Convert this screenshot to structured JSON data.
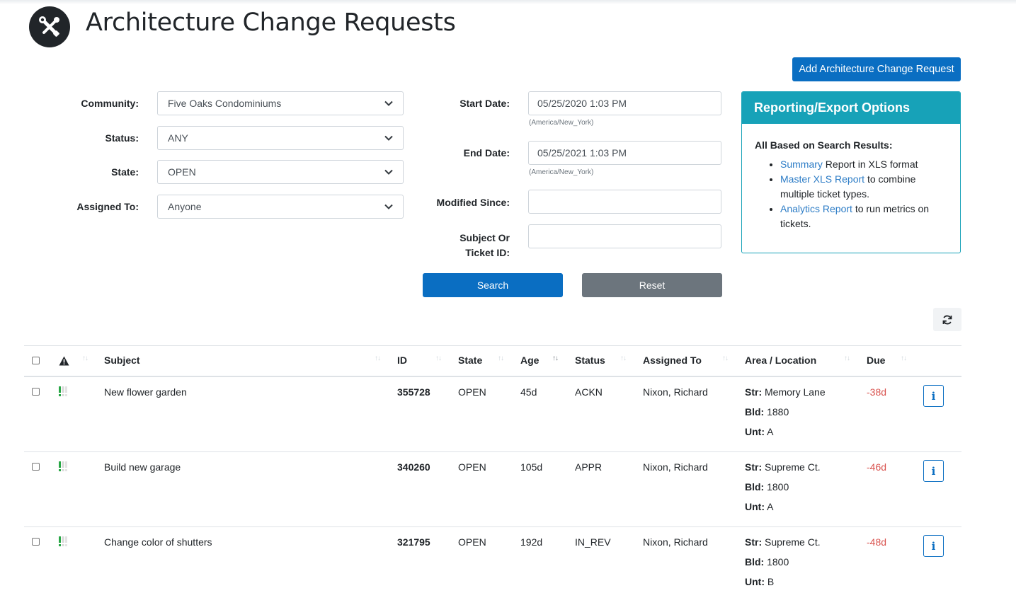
{
  "header": {
    "title": "Architecture Change Requests",
    "add_button": "Add Architecture Change Request"
  },
  "filters": {
    "community": {
      "label": "Community:",
      "value": "Five Oaks Condominiums"
    },
    "status": {
      "label": "Status:",
      "value": "ANY"
    },
    "state": {
      "label": "State:",
      "value": "OPEN"
    },
    "assigned": {
      "label": "Assigned To:",
      "value": "Anyone"
    },
    "start_date": {
      "label": "Start Date:",
      "value": "05/25/2020 1:03 PM",
      "tz": "(America/New_York)"
    },
    "end_date": {
      "label": "End Date:",
      "value": "05/25/2021 1:03 PM",
      "tz": "(America/New_York)"
    },
    "modified_since": {
      "label": "Modified Since:",
      "value": ""
    },
    "subject": {
      "label_line1": "Subject Or",
      "label_line2": "Ticket ID:",
      "value": ""
    },
    "search_button": "Search",
    "reset_button": "Reset"
  },
  "report": {
    "title": "Reporting/Export Options",
    "subtitle": "All Based on Search Results:",
    "items": [
      {
        "link": "Summary",
        "text": " Report in XLS format"
      },
      {
        "link": "Master XLS Report",
        "text": " to combine multiple ticket types."
      },
      {
        "link": "Analytics Report",
        "text": " to run metrics on tickets."
      }
    ]
  },
  "table": {
    "columns": {
      "subject": "Subject",
      "id": "ID",
      "state": "State",
      "age": "Age",
      "status": "Status",
      "assigned": "Assigned To",
      "area": "Area / Location",
      "due": "Due"
    },
    "area_labels": {
      "str": "Str:",
      "bld": "Bld:",
      "unt": "Unt:"
    },
    "info_label": "i",
    "rows": [
      {
        "subject": "New flower garden",
        "id": "355728",
        "state": "OPEN",
        "age": "45d",
        "status": "ACKN",
        "assigned": "Nixon, Richard",
        "str": "Memory Lane",
        "bld": "1880",
        "unt": "A",
        "due": "-38d"
      },
      {
        "subject": "Build new garage",
        "id": "340260",
        "state": "OPEN",
        "age": "105d",
        "status": "APPR",
        "assigned": "Nixon, Richard",
        "str": "Supreme Ct.",
        "bld": "1800",
        "unt": "A",
        "due": "-46d"
      },
      {
        "subject": "Change color of shutters",
        "id": "321795",
        "state": "OPEN",
        "age": "192d",
        "status": "IN_REV",
        "assigned": "Nixon, Richard",
        "str": "Supreme Ct.",
        "bld": "1800",
        "unt": "B",
        "due": "-48d"
      }
    ]
  },
  "colors": {
    "primary": "#0a6ec2",
    "info": "#17a2b8",
    "secondary": "#6c757d",
    "danger": "#d9534f",
    "priority": "#28a745"
  }
}
